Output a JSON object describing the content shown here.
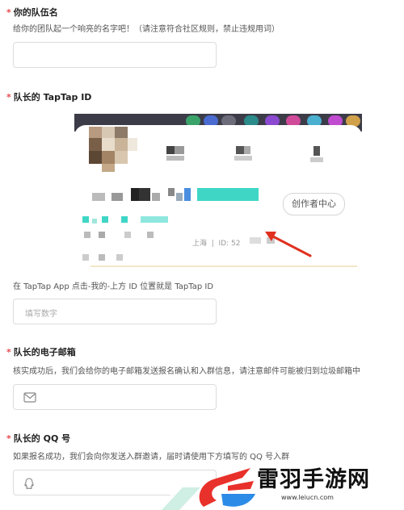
{
  "sections": {
    "team_name": {
      "label": "你的队伍名",
      "hint": "给你的团队起一个响亮的名字吧！（请注意符合社区规则，禁止违规用词）"
    },
    "captain_id": {
      "label": "队长的 TapTap ID",
      "hint": "在 TapTap App 点击-我的-上方 ID 位置就是 TapTap ID",
      "placeholder": "填写数字",
      "screenshot": {
        "creator_button": "创作者中心",
        "location_text": "上海",
        "id_text": "ID: 52"
      }
    },
    "captain_email": {
      "label": "队长的电子邮箱",
      "hint": "核实成功后，我们会给你的电子邮箱发送报名确认和入群信息，请注意邮件可能被归到垃圾邮箱中"
    },
    "captain_qq": {
      "label": "队长的 QQ 号",
      "hint": "如果报名成功，我们会向你发送入群邀请，届时请使用下方填写的 QQ 号入群"
    }
  },
  "required_mark": "*",
  "watermark": {
    "text": "雷羽手游网",
    "url": "www.leiucn.com"
  },
  "colors": {
    "required": "#e5484d",
    "arrow": "#e0301e",
    "teal": "#3fd6c6"
  }
}
